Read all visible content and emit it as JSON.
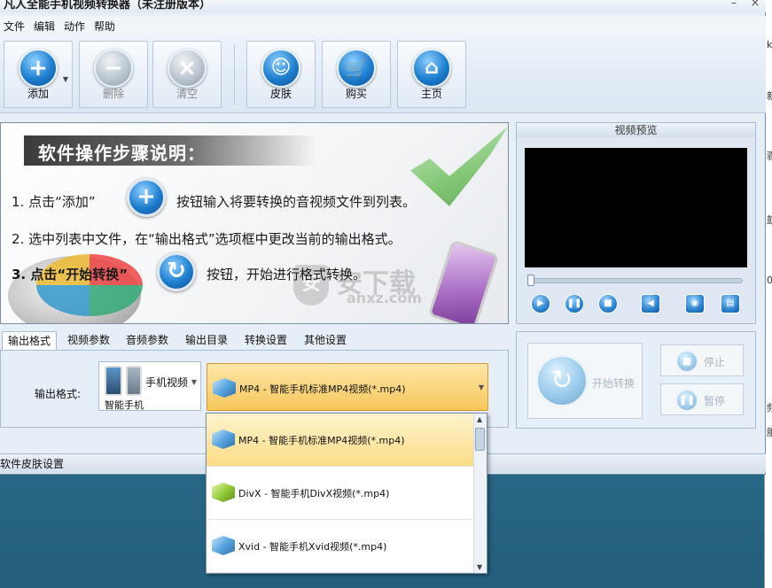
{
  "window": {
    "title": "凡人全能手机视频转换器（未注册版本）",
    "controls": {
      "minimize": "–",
      "close": "×"
    }
  },
  "menu": [
    "文件",
    "编辑",
    "动作",
    "帮助"
  ],
  "toolbar": {
    "add": "添加",
    "delete": "删除",
    "clear": "清空",
    "skin": "皮肤",
    "buy": "购买",
    "home": "主页"
  },
  "banner": {
    "heading": "软件操作步骤说明：",
    "step1_a": "1. 点击“添加”",
    "step1_b": "按钮输入将要转换的音视频文件到列表。",
    "step2": "2. 选中列表中文件，在“输出格式”选项框中更改当前的输出格式。",
    "step3_a": "3. 点击“开始转换”",
    "step3_b": "按钮，开始进行格式转换。",
    "watermark_main": "安下载",
    "watermark_sub": "anxz.com"
  },
  "preview": {
    "title": "视频预览",
    "progress": 0
  },
  "tabs": [
    "输出格式",
    "视频参数",
    "音频参数",
    "输出目录",
    "转换设置",
    "其他设置"
  ],
  "active_tab": 0,
  "output": {
    "label": "输出格式:",
    "device_name": "手机视频",
    "device_sub": "智能手机",
    "selected_format": "MP4 - 智能手机标准MP4视频(*.mp4)"
  },
  "dropdown": {
    "items": [
      {
        "label": "MP4 - 智能手机标准MP4视频(*.mp4)",
        "selected": true,
        "icon": "blue-cube-icon"
      },
      {
        "label": "DivX - 智能手机DivX视频(*.mp4)",
        "selected": false,
        "icon": "green-cube-icon"
      },
      {
        "label": "Xvid - 智能手机Xvid视频(*.mp4)",
        "selected": false,
        "icon": "blue-cube-icon"
      }
    ]
  },
  "convert": {
    "start": "开始转换",
    "stop": "停止",
    "pause": "暂停"
  },
  "status": {
    "text": "软件皮肤设置"
  },
  "background_window_chars": [
    "k",
    "新",
    "骤",
    "鼓",
    "0",
    "频",
    "服"
  ]
}
